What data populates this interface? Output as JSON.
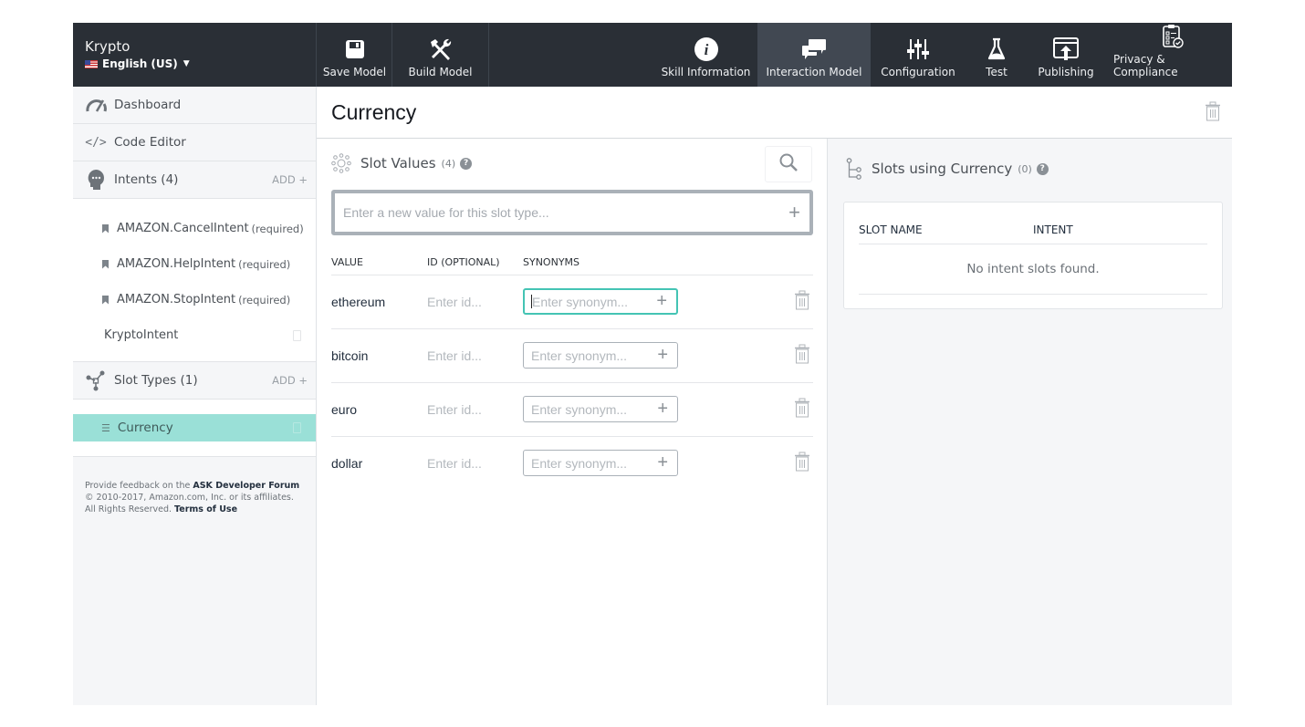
{
  "header": {
    "skill_name": "Krypto",
    "locale": "English (US)",
    "buttons": [
      {
        "id": "save",
        "label": "Save Model",
        "icon": "floppy-disk-icon"
      },
      {
        "id": "build",
        "label": "Build Model",
        "icon": "hammer-wrench-icon"
      },
      {
        "id": "skill-info",
        "label": "Skill Information",
        "icon": "info-icon"
      },
      {
        "id": "interaction-model",
        "label": "Interaction Model",
        "icon": "chat-bubbles-icon",
        "active": true
      },
      {
        "id": "configuration",
        "label": "Configuration",
        "icon": "sliders-icon"
      },
      {
        "id": "test",
        "label": "Test",
        "icon": "flask-icon"
      },
      {
        "id": "publishing",
        "label": "Publishing",
        "icon": "upload-window-icon"
      },
      {
        "id": "privacy",
        "label": "Privacy & Compliance",
        "icon": "clipboard-check-icon"
      }
    ]
  },
  "sidebar": {
    "dashboard": "Dashboard",
    "code_editor": "Code Editor",
    "intents_label": "Intents (4)",
    "add_label": "ADD +",
    "intents": [
      {
        "name": "AMAZON.CancelIntent",
        "tag": "(required)"
      },
      {
        "name": "AMAZON.HelpIntent",
        "tag": "(required)"
      },
      {
        "name": "AMAZON.StopIntent",
        "tag": "(required)"
      },
      {
        "name": "KryptoIntent",
        "tag": ""
      }
    ],
    "slot_types_label": "Slot Types (1)",
    "slot_types": [
      {
        "name": "Currency",
        "selected": true
      }
    ],
    "footer": {
      "feedback_prefix": "Provide feedback on the ",
      "forum_link": "ASK Developer Forum",
      "copyright": "© 2010-2017, Amazon.com, Inc. or its affiliates.",
      "rights": "All Rights Reserved. ",
      "terms_link": "Terms of Use"
    }
  },
  "main": {
    "title": "Currency",
    "slot_values": {
      "title": "Slot Values",
      "count": "(4)",
      "new_value_placeholder": "Enter a new value for this slot type...",
      "columns": [
        "VALUE",
        "ID (OPTIONAL)",
        "SYNONYMS"
      ],
      "id_placeholder": "Enter id...",
      "synonym_placeholder": "Enter synonym...",
      "rows": [
        {
          "value": "ethereum",
          "focused": true
        },
        {
          "value": "bitcoin"
        },
        {
          "value": "euro"
        },
        {
          "value": "dollar"
        }
      ]
    },
    "slots_using": {
      "title": "Slots using Currency",
      "count": "(0)",
      "columns": [
        "SLOT NAME",
        "INTENT"
      ],
      "empty_message": "No intent slots found."
    }
  },
  "colors": {
    "topbar": "#2a2f36",
    "active_tab": "#414852",
    "selected_slot": "#9ae0d7",
    "focus_border": "#44c4b4"
  }
}
